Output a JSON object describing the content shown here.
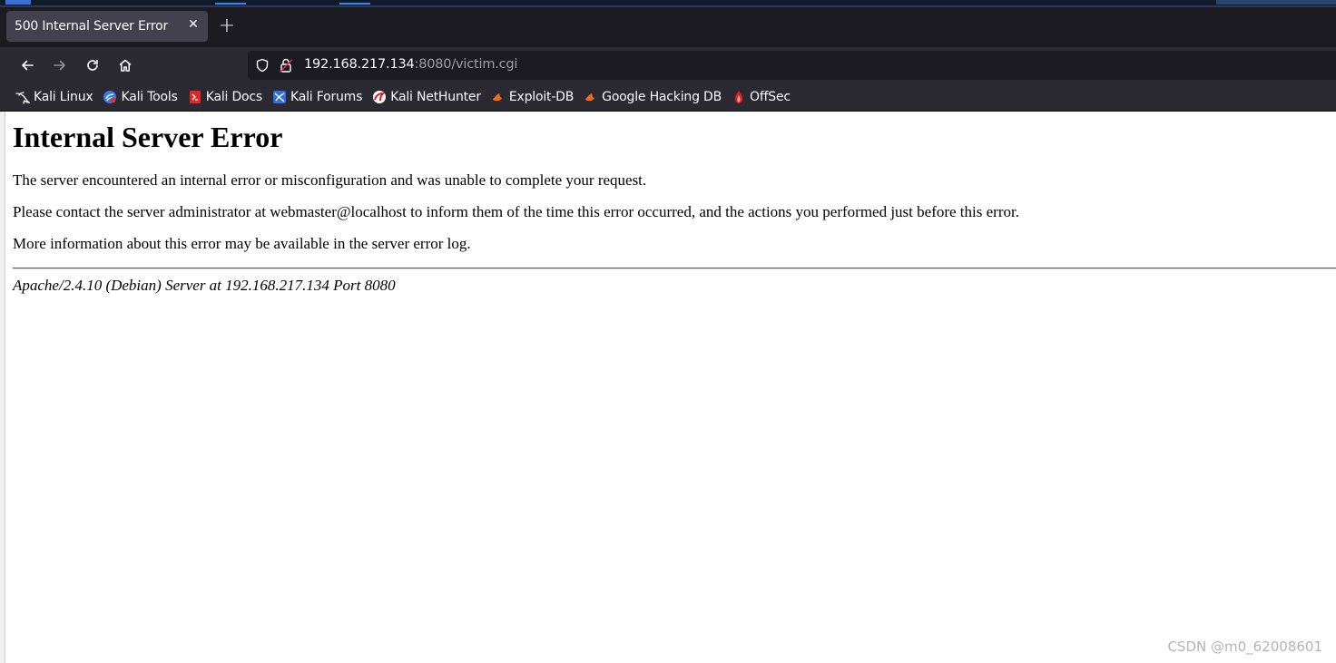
{
  "tab": {
    "title": "500 Internal Server Error",
    "close_glyph": "✕"
  },
  "newtab": {
    "glyph": "+"
  },
  "nav": {
    "back_icon": "arrow-left-icon",
    "forward_icon": "arrow-right-icon",
    "reload_icon": "reload-icon",
    "home_icon": "home-icon"
  },
  "url": {
    "host": "192.168.217.134",
    "rest": ":8080/victim.cgi"
  },
  "bookmarks": [
    {
      "label": "Kali Linux",
      "icon": "kali-dragon-icon"
    },
    {
      "label": "Kali Tools",
      "icon": "kali-tools-icon"
    },
    {
      "label": "Kali Docs",
      "icon": "kali-docs-icon"
    },
    {
      "label": "Kali Forums",
      "icon": "kali-forums-icon"
    },
    {
      "label": "Kali NetHunter",
      "icon": "nethunter-icon"
    },
    {
      "label": "Exploit-DB",
      "icon": "exploit-db-icon"
    },
    {
      "label": "Google Hacking DB",
      "icon": "ghdb-icon"
    },
    {
      "label": "OffSec",
      "icon": "offsec-icon"
    }
  ],
  "page": {
    "heading": "Internal Server Error",
    "p1": "The server encountered an internal error or misconfiguration and was unable to complete your request.",
    "p2": "Please contact the server administrator at webmaster@localhost to inform them of the time this error occurred, and the actions you performed just before this error.",
    "p3": "More information about this error may be available in the server error log.",
    "address": "Apache/2.4.10 (Debian) Server at 192.168.217.134 Port 8080"
  },
  "watermark": "CSDN @m0_62008601",
  "colors": {
    "tab_bg": "#42414d",
    "toolbar_bg": "#2b2a33",
    "urlbar_bg": "#1c1b22",
    "text_light": "#fbfbfe",
    "url_dim": "#9e9ea6"
  }
}
